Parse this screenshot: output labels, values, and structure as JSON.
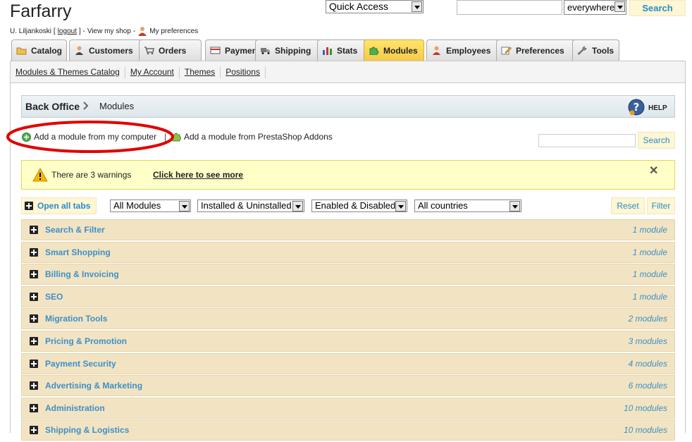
{
  "header": {
    "shop_title": "Farfarry",
    "user_name": "U. Liljankoski",
    "logout_label": "logout",
    "view_shop_label": "View my shop",
    "preferences_label": "My preferences",
    "quick_access": "Quick Access",
    "search_value": "",
    "search_scope": "everywhere",
    "search_button": "Search"
  },
  "tabs": [
    {
      "label": "Catalog",
      "icon": "folder-icon"
    },
    {
      "label": "Customers",
      "icon": "person-icon"
    },
    {
      "label": "Orders",
      "icon": "cart-icon"
    },
    {
      "label": "Payment",
      "icon": "card-icon"
    },
    {
      "label": "Shipping",
      "icon": "truck-icon"
    },
    {
      "label": "Stats",
      "icon": "bar-chart-icon"
    },
    {
      "label": "Modules",
      "icon": "puzzle-icon",
      "active": true
    },
    {
      "label": "Employees",
      "icon": "employee-icon"
    },
    {
      "label": "Preferences",
      "icon": "pencil-icon"
    },
    {
      "label": "Tools",
      "icon": "wrench-icon"
    }
  ],
  "subtabs": [
    "Modules & Themes Catalog",
    "My Account",
    "Themes",
    "Positions"
  ],
  "breadcrumb": {
    "root": "Back Office",
    "current": "Modules",
    "help": "HELP"
  },
  "actions": {
    "add_from_computer": "Add a module from my computer",
    "separator": "|",
    "add_from_addons": "Add a module from PrestaShop Addons",
    "search_button": "Search",
    "search_value": ""
  },
  "warning": {
    "text": "There are 3 warnings",
    "link": "Click here to see more",
    "close": "✕"
  },
  "filters": {
    "open_all": "Open all tabs",
    "modules": "All Modules",
    "install_state": "Installed & Uninstalled",
    "enabled_state": "Enabled & Disabled",
    "countries": "All countries",
    "reset": "Reset",
    "filter": "Filter"
  },
  "categories": [
    {
      "name": "Search & Filter",
      "count": "1 module"
    },
    {
      "name": "Smart Shopping",
      "count": "1 module"
    },
    {
      "name": "Billing & Invoicing",
      "count": "1 module"
    },
    {
      "name": "SEO",
      "count": "1 module"
    },
    {
      "name": "Migration Tools",
      "count": "2 modules"
    },
    {
      "name": "Pricing & Promotion",
      "count": "3 modules"
    },
    {
      "name": "Payment Security",
      "count": "4 modules"
    },
    {
      "name": "Advertising & Marketing",
      "count": "6 modules"
    },
    {
      "name": "Administration",
      "count": "10 modules"
    },
    {
      "name": "Shipping & Logistics",
      "count": "10 modules"
    }
  ],
  "colors": {
    "accent_link": "#3d8fc9",
    "row_bg": "#f2e4c2",
    "active_tab": "#f5c94a",
    "warning_bg": "#ffffc8",
    "annotation": "#e00000"
  }
}
